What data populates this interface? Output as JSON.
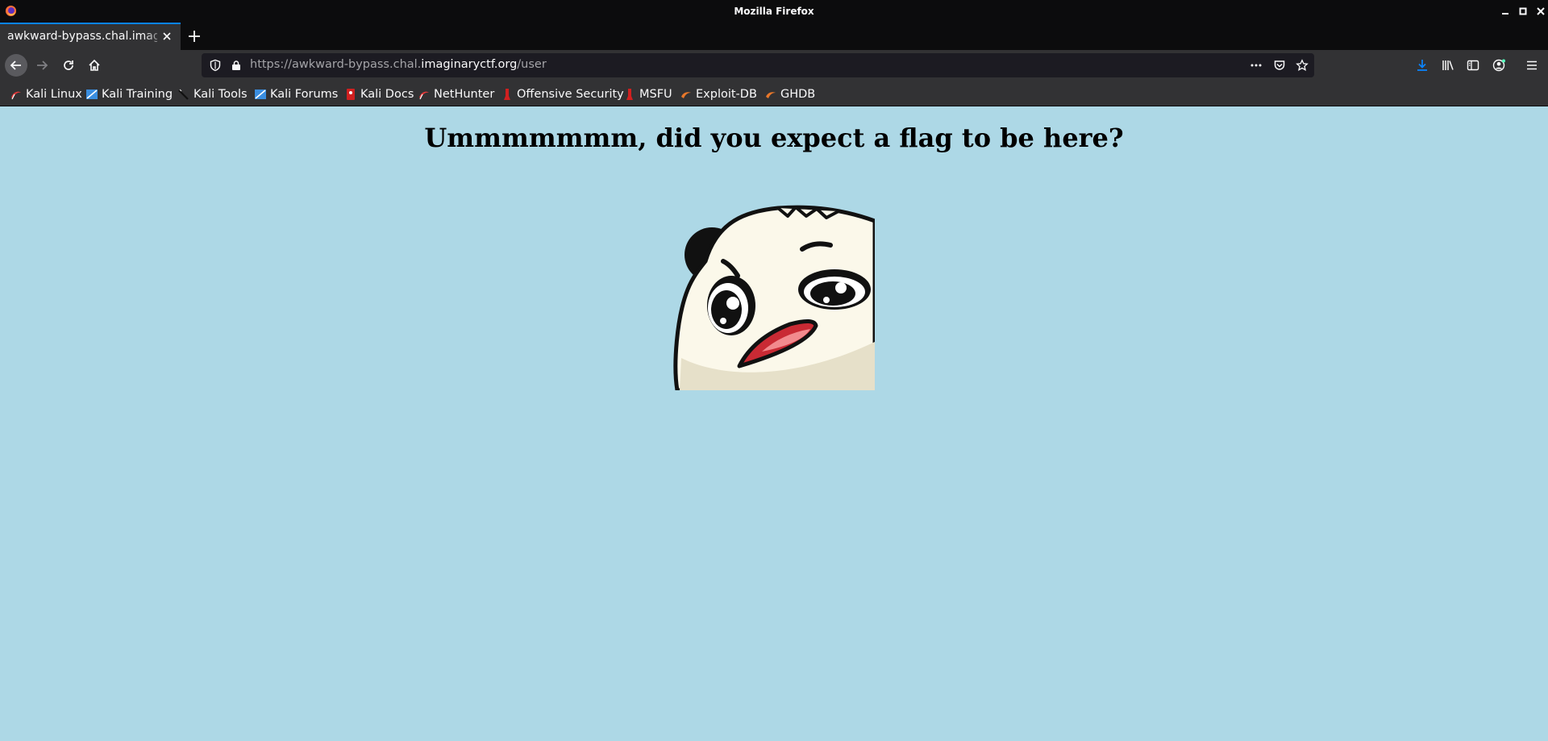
{
  "window": {
    "title": "Mozilla Firefox"
  },
  "tab": {
    "title": "awkward-bypass.chal.imaginaryctf.org/user"
  },
  "url": {
    "prefix": "https://awkward-bypass.chal.",
    "host": "imaginaryctf.org",
    "path": "/user"
  },
  "bookmarks": [
    {
      "label": "Kali Linux",
      "icon": "kali-linux-icon",
      "color": "#e03a3a"
    },
    {
      "label": "Kali Training",
      "icon": "kali-training-icon",
      "color": "#3a8ee0"
    },
    {
      "label": "Kali Tools",
      "icon": "kali-tools-icon",
      "color": "#222222"
    },
    {
      "label": "Kali Forums",
      "icon": "kali-forums-icon",
      "color": "#3a8ee0"
    },
    {
      "label": "Kali Docs",
      "icon": "kali-docs-icon",
      "color": "#d02020"
    },
    {
      "label": "NetHunter",
      "icon": "nethunter-icon",
      "color": "#e03a3a"
    },
    {
      "label": "Offensive Security",
      "icon": "offsec-icon",
      "color": "#d02020"
    },
    {
      "label": "MSFU",
      "icon": "msfu-icon",
      "color": "#d02020"
    },
    {
      "label": "Exploit-DB",
      "icon": "exploit-db-icon",
      "color": "#e8772a"
    },
    {
      "label": "GHDB",
      "icon": "ghdb-icon",
      "color": "#e8772a"
    }
  ],
  "page": {
    "heading": "Ummmmmmm, did you expect a flag to be here?",
    "background": "#add8e6",
    "image": "panda-emote"
  },
  "colors": {
    "accent": "#0a84ff",
    "chrome_dark": "#0c0c0d",
    "chrome": "#323234",
    "urlbar": "#1c1b22"
  }
}
